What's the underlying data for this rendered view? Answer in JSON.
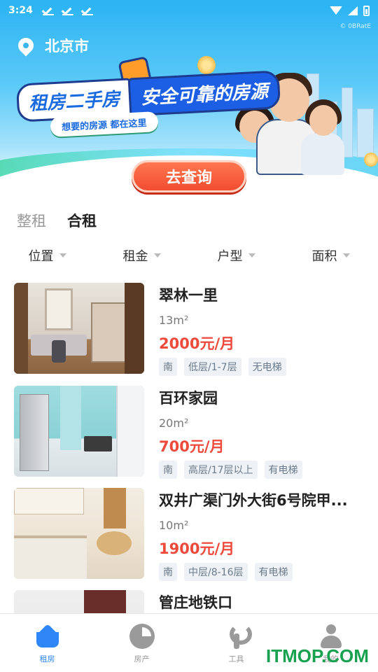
{
  "status_bar": {
    "time": "3:24"
  },
  "banner": {
    "city": "北京市",
    "title_a": "租房二手房",
    "title_b": "安全可靠的房源",
    "subtitle": "想要的房源 都在这里",
    "cta_label": "去查询",
    "corner_text": "© 0BRatE"
  },
  "tabs": [
    {
      "label": "整租",
      "active": false
    },
    {
      "label": "合租",
      "active": true
    }
  ],
  "filters": [
    {
      "label": "位置"
    },
    {
      "label": "租金"
    },
    {
      "label": "户型"
    },
    {
      "label": "面积"
    }
  ],
  "listings": [
    {
      "name": "翠林一里",
      "area": "13m²",
      "price": "2000元/月",
      "tags": [
        "南",
        "低层/1-7层",
        "无电梯"
      ]
    },
    {
      "name": "百环家园",
      "area": "20m²",
      "price": "700元/月",
      "tags": [
        "南",
        "高层/17层以上",
        "有电梯"
      ]
    },
    {
      "name": "双井广渠门外大街6号院甲...",
      "area": "10m²",
      "price": "1900元/月",
      "tags": [
        "南",
        "中层/8-16层",
        "有电梯"
      ]
    },
    {
      "name": "管庄地铁口",
      "area": "",
      "price": "",
      "tags": []
    }
  ],
  "bottom_nav": [
    {
      "label": "租房",
      "icon": "home-icon",
      "active": true
    },
    {
      "label": "房产",
      "icon": "pie-chart-icon",
      "active": false
    },
    {
      "label": "工具",
      "icon": "wrench-icon",
      "active": false
    },
    {
      "label": "我的",
      "icon": "user-icon",
      "active": false
    }
  ],
  "watermark": "ITMOP.COM",
  "colors": {
    "primary": "#2f86f6",
    "price": "#ee4a3b",
    "cta": "#f2492e",
    "tab_underline": "#6ee0b0"
  }
}
